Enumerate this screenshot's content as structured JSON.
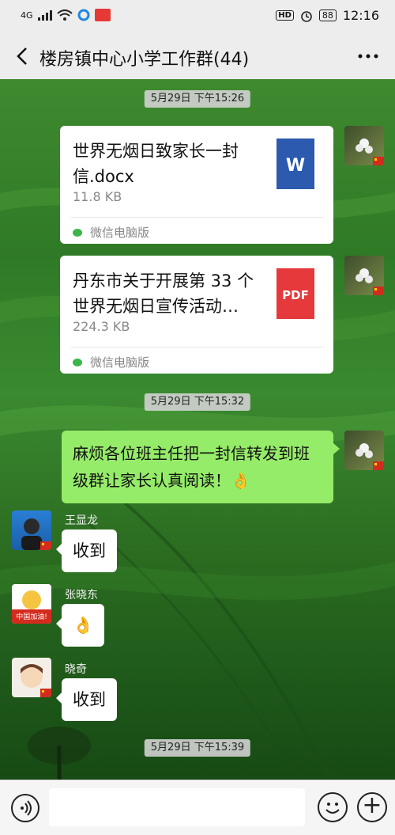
{
  "status_bar": {
    "network": "4G",
    "time": "12:16",
    "hd": "HD",
    "battery": "88"
  },
  "header": {
    "back_icon": "chevron-left-icon",
    "title": "楼房镇中心小学工作群(44)",
    "more_icon": "more-dots-icon"
  },
  "messages": {
    "ts1": "5月29日  下午15:26",
    "file1": {
      "name": "世界无烟日致家长一封信.docx",
      "size": "11.8 KB",
      "source": "微信电脑版",
      "icon_label": "W",
      "icon_color": "#2b5aaf"
    },
    "file2": {
      "name": "丹东市关于开展第 33 个世界无烟日宣传活动…",
      "size": "224.3 KB",
      "source": "微信电脑版",
      "icon_label": "PDF",
      "icon_color": "#e5393b"
    },
    "ts2": "5月29日  下午15:32",
    "text1": "麻烦各位班主任把一封信转发到班级群让家长认真阅读！👌",
    "msg_wang": {
      "sender": "王显龙",
      "text": "收到"
    },
    "msg_zhang": {
      "sender": "张晓东",
      "text": "👌",
      "avatar_text": "中国加油!"
    },
    "msg_xiao": {
      "sender": "晓奇",
      "text": "收到"
    },
    "ts3": "5月29日  下午15:39"
  },
  "input_bar": {
    "voice_icon": "voice-icon",
    "emoji_icon": "emoji-icon",
    "plus_icon": "plus-icon",
    "plus_symbol": "+"
  },
  "colors": {
    "bubble_self": "#95ec69",
    "bubble_other": "#ffffff",
    "bar_bg": "#ededed"
  }
}
